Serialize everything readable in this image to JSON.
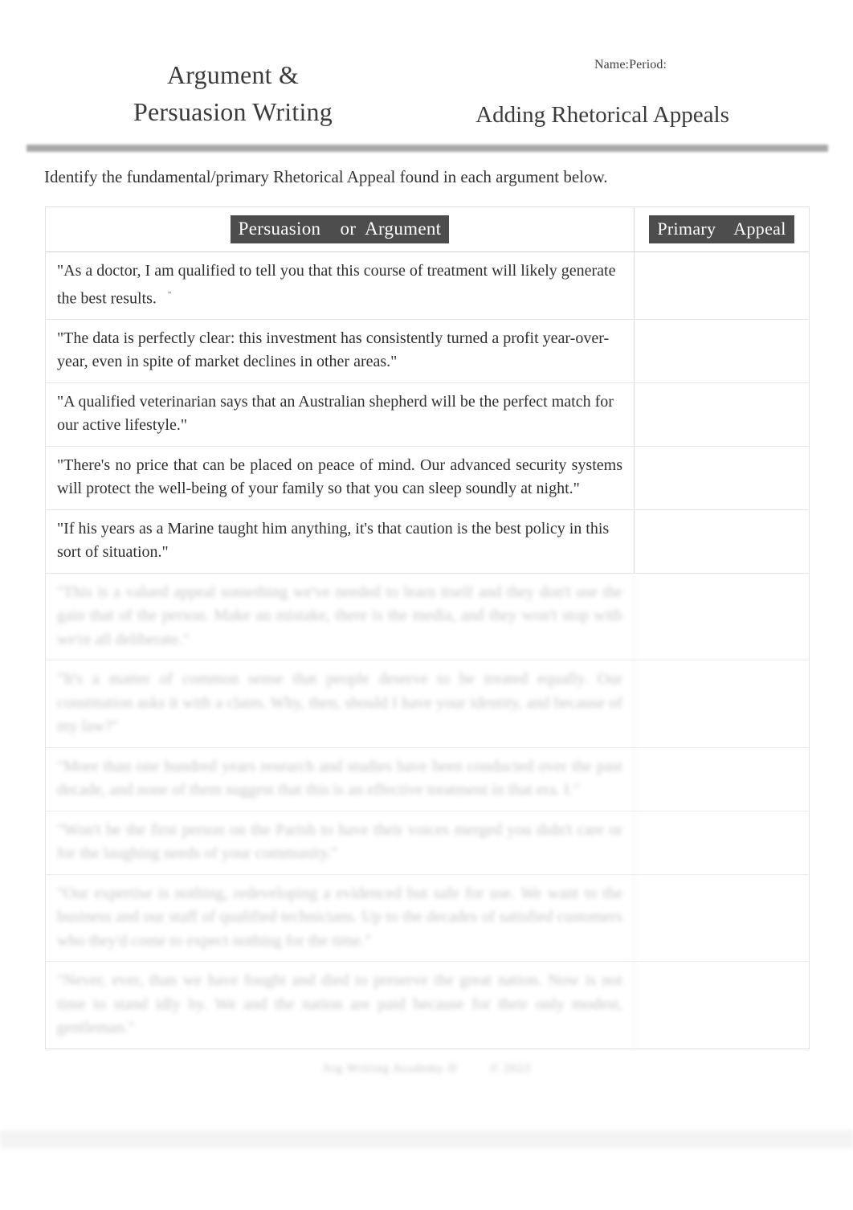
{
  "header": {
    "doc_title": "Argument  &\nPersuasion Writing",
    "name_period": "Name:Period:",
    "worksheet_title": "Adding Rhetorical Appeals"
  },
  "instruction": "Identify the fundamental/primary Rhetorical Appeal found in each argument below.",
  "table": {
    "columns": {
      "argument_header": "Persuasion    or  Argument",
      "appeal_header": "Primary    Appeal"
    },
    "rows": [
      {
        "argument": "\"As a doctor, I am qualified to tell you that this course of treatment will likely generate   the  best  results.",
        "trailing_mark": "\"",
        "appeal": "",
        "blurred": false,
        "justified": false
      },
      {
        "argument": "\"The data is perfectly clear: this investment has consistently turned a profit year-over-year, even in spite of market declines in other areas.\"",
        "trailing_mark": "",
        "appeal": "",
        "blurred": false,
        "justified": false
      },
      {
        "argument": "\"A qualified veterinarian says that an Australian shepherd will be the perfect match for our active lifestyle.\"",
        "trailing_mark": "",
        "appeal": "",
        "blurred": false,
        "justified": false
      },
      {
        "argument": "\"There's   no  price  that  can  be  placed  on  peace  of  mind.  Our advanced security systems will protect the well-being of your family so that you can sleep soundly at night.\"",
        "trailing_mark": "",
        "appeal": "",
        "blurred": false,
        "justified": true
      },
      {
        "argument": "\"If his years as a Marine taught him anything, it's that caution is the best policy in this sort of situation.\"",
        "trailing_mark": "",
        "appeal": "",
        "blurred": false,
        "justified": false
      },
      {
        "argument": "\"This is a valued appeal something we've needed to learn itself and they don't use the gain that of the person. Make an mistake, there is the media, and they won't stop with we're all deliberate.\"",
        "trailing_mark": "",
        "appeal": "",
        "blurred": true,
        "justified": true
      },
      {
        "argument": "\"It's a matter of common sense that people deserve to be treated equally. Our constitution asks it with a claim. Why, then, should I have your identity, and because of my law?\"",
        "trailing_mark": "",
        "appeal": "",
        "blurred": true,
        "justified": true
      },
      {
        "argument": "\"More than one hundred years research and studies have been conducted over the past decade, and none of them suggest that this is an effective   treatment   in  that  era.  I.\"",
        "trailing_mark": "",
        "appeal": "",
        "blurred": true,
        "justified": true
      },
      {
        "argument": "\"Won't be the first person on the Parish to have their voices merged you didn't care or for the laughing needs of your community.\"",
        "trailing_mark": "",
        "appeal": "",
        "blurred": true,
        "justified": true
      },
      {
        "argument": "\"Our expertise is nothing, redeveloping a evidenced but safe for use. We want to the business and our staff of qualified technicians. Up to the decades of satisfied customers who they'd come to expect nothing for the time.\"",
        "trailing_mark": "",
        "appeal": "",
        "blurred": true,
        "justified": true
      },
      {
        "argument": "\"Never, ever, than we have fought and died to preserve the great nation. Now is not time to stand idly by. We and the nation are paid because for their only modest, gentleman.\"",
        "trailing_mark": "",
        "appeal": "",
        "blurred": true,
        "justified": true
      }
    ]
  },
  "footer": {
    "text": "Arg Writing Academy II",
    "number": "© 2023"
  },
  "colors": {
    "highlight_bg": "#4d4d4d",
    "highlight_text": "#ffffff",
    "rule": "#a8a8a8",
    "body_text": "#2f2f2f",
    "page_bg": "#ffffff"
  }
}
